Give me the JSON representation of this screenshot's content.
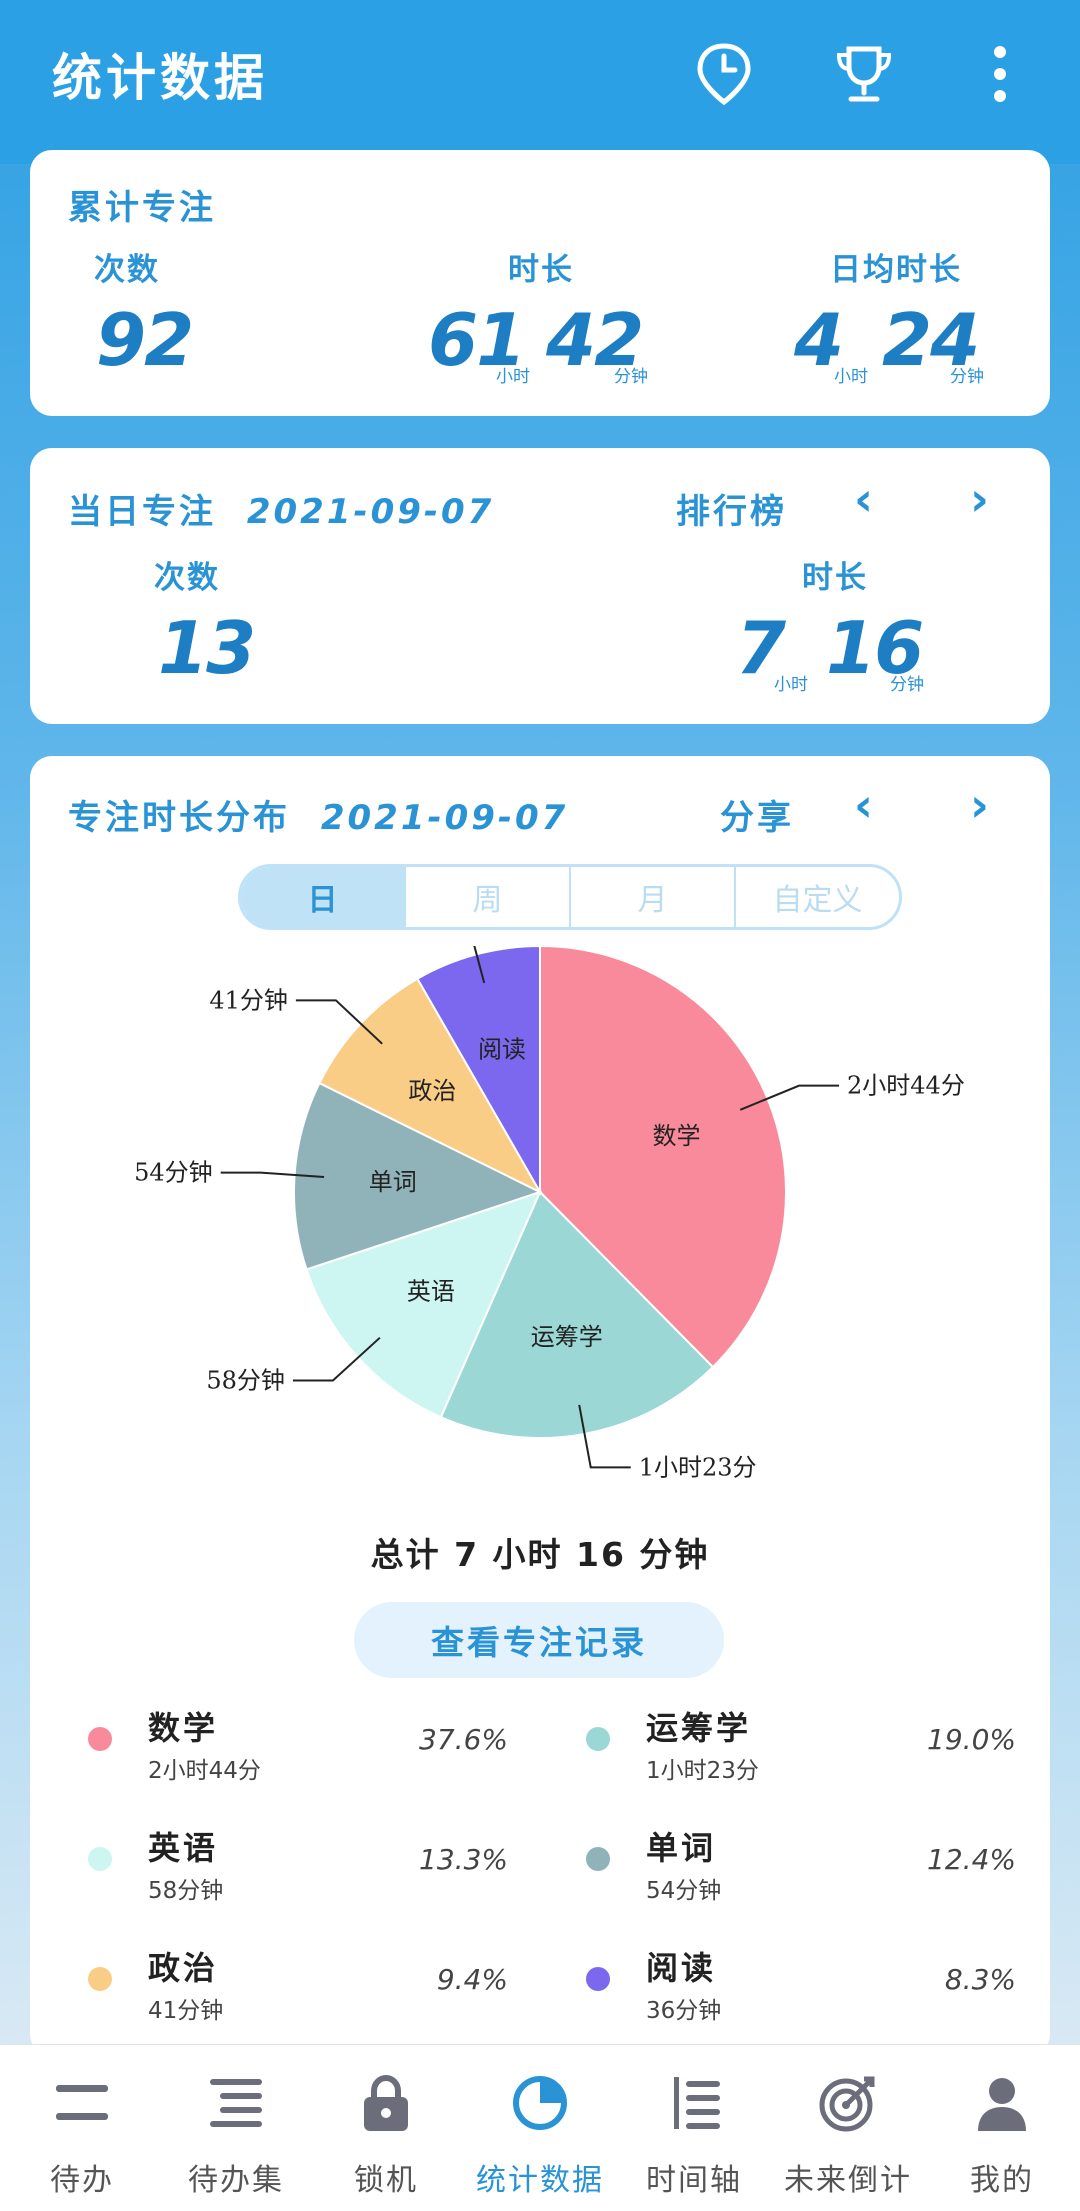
{
  "header": {
    "title": "统计数据",
    "icons": [
      "clock-pin-icon",
      "trophy-icon",
      "more-vert-icon"
    ]
  },
  "cumulative": {
    "title": "累计专注",
    "count_label": "次数",
    "count": "92",
    "duration_label": "时长",
    "duration_hours": "61",
    "duration_hours_unit": "小时",
    "duration_minutes": "42",
    "duration_minutes_unit": "分钟",
    "daily_avg_label": "日均时长",
    "daily_avg_hours": "4",
    "daily_avg_hours_unit": "小时",
    "daily_avg_minutes": "24",
    "daily_avg_minutes_unit": "分钟"
  },
  "daily": {
    "title": "当日专注",
    "date": "2021-09-07",
    "ranking_label": "排行榜",
    "count_label": "次数",
    "count": "13",
    "duration_label": "时长",
    "duration_hours": "7",
    "duration_hours_unit": "小时",
    "duration_minutes": "16",
    "duration_minutes_unit": "分钟"
  },
  "distribution": {
    "title": "专注时长分布",
    "date": "2021-09-07",
    "share_label": "分享",
    "tabs": [
      "日",
      "周",
      "月",
      "自定义"
    ],
    "active_tab": "日",
    "total_text": "总计 7 小时 16 分钟",
    "view_records_label": "查看专注记录"
  },
  "chart_data": {
    "type": "pie",
    "categories": [
      "数学",
      "运筹学",
      "英语",
      "单词",
      "政治",
      "阅读"
    ],
    "values": [
      37.6,
      19.0,
      13.3,
      12.4,
      9.4,
      8.3
    ],
    "duration_labels": [
      "2小时44分",
      "1小时23分",
      "58分钟",
      "54分钟",
      "41分钟",
      "36分钟"
    ],
    "legend_times": [
      "2小时44分",
      "1小时23分",
      "58分钟",
      "54分钟",
      "41分钟",
      "36分钟"
    ],
    "percent_labels": [
      "37.6%",
      "19.0%",
      "13.3%",
      "12.4%",
      "9.4%",
      "8.3%"
    ],
    "colors": [
      "#f98a9b",
      "#9ad7d5",
      "#cdf6f2",
      "#8fb3b9",
      "#f9cd85",
      "#7b68ee"
    ]
  },
  "nav": {
    "items": [
      {
        "label": "待办",
        "icon": "todo-icon"
      },
      {
        "label": "待办集",
        "icon": "todo-collection-icon"
      },
      {
        "label": "锁机",
        "icon": "lock-icon"
      },
      {
        "label": "统计数据",
        "icon": "pie-chart-icon"
      },
      {
        "label": "时间轴",
        "icon": "timeline-icon"
      },
      {
        "label": "未来倒计",
        "icon": "target-icon"
      },
      {
        "label": "我的",
        "icon": "user-icon"
      }
    ],
    "active": 3
  }
}
